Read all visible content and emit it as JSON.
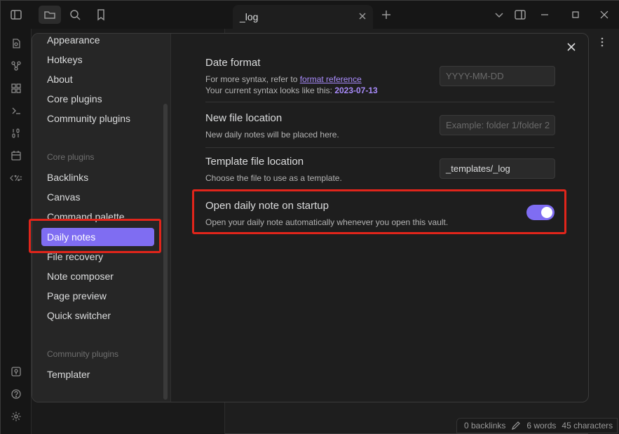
{
  "tab": {
    "title": "_log"
  },
  "settings_nav": {
    "top_items": [
      "Appearance",
      "Hotkeys",
      "About",
      "Core plugins",
      "Community plugins"
    ],
    "core_group_label": "Core plugins",
    "core_items": [
      "Backlinks",
      "Canvas",
      "Command palette",
      "Daily notes",
      "File recovery",
      "Note composer",
      "Page preview",
      "Quick switcher"
    ],
    "community_group_label": "Community plugins",
    "community_items": [
      "Templater"
    ],
    "active_item": "Daily notes"
  },
  "settings": {
    "date_format": {
      "name": "Date format",
      "desc_prefix": "For more syntax, refer to ",
      "desc_link": "format reference",
      "desc_line2_prefix": "Your current syntax looks like this: ",
      "desc_line2_value": "2023-07-13",
      "placeholder": "YYYY-MM-DD",
      "value": ""
    },
    "new_file_location": {
      "name": "New file location",
      "desc": "New daily notes will be placed here.",
      "placeholder": "Example: folder 1/folder 2",
      "value": ""
    },
    "template_file_location": {
      "name": "Template file location",
      "desc": "Choose the file to use as a template.",
      "value": "_templates/_log"
    },
    "open_on_startup": {
      "name": "Open daily note on startup",
      "desc": "Open your daily note automatically whenever you open this vault.",
      "enabled": true
    }
  },
  "statusbar": {
    "backlinks": "0 backlinks",
    "words": "6 words",
    "characters": "45 characters"
  },
  "colors": {
    "accent": "#7f6df2",
    "highlight": "#e1251b"
  }
}
